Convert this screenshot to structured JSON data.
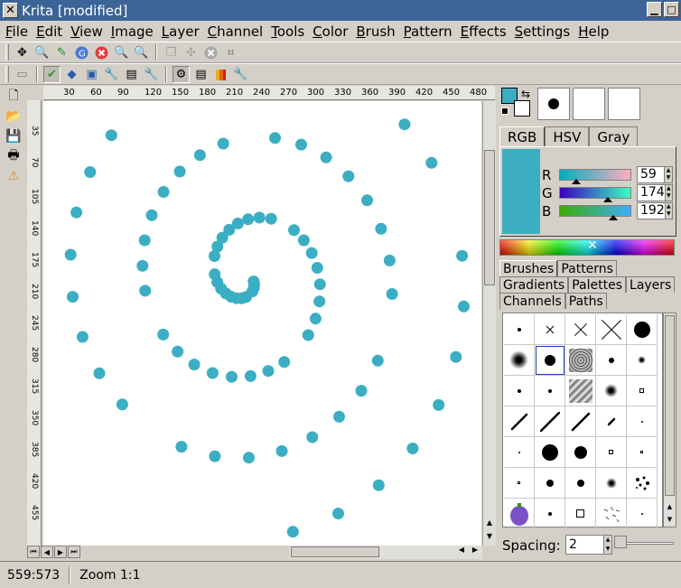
{
  "window": {
    "title": "Krita [modified]"
  },
  "menu": [
    "File",
    "Edit",
    "View",
    "Image",
    "Layer",
    "Channel",
    "Tools",
    "Color",
    "Brush",
    "Pattern",
    "Effects",
    "Settings",
    "Help"
  ],
  "ruler": {
    "h_ticks": [
      "30",
      "60",
      "90",
      "120",
      "150",
      "180",
      "210",
      "240",
      "270",
      "300",
      "330",
      "360",
      "390",
      "420",
      "450",
      "480"
    ],
    "v_ticks": [
      "35",
      "70",
      "105",
      "140",
      "175",
      "210",
      "245",
      "280",
      "315",
      "350",
      "385",
      "420",
      "455"
    ]
  },
  "colors": {
    "accent": "#3baec3",
    "fg": "#3baec3",
    "bg": "#ffffff"
  },
  "color_panel": {
    "tabs": [
      "RGB",
      "HSV",
      "Gray"
    ],
    "active_tab": "RGB",
    "channels": [
      {
        "label": "R",
        "value": "59",
        "fraction": 0.23
      },
      {
        "label": "G",
        "value": "174",
        "fraction": 0.68
      },
      {
        "label": "B",
        "value": "192",
        "fraction": 0.75
      }
    ]
  },
  "docker_tabs": {
    "row1": [
      "Brushes",
      "Patterns"
    ],
    "row2": [
      "Gradients",
      "Palettes",
      "Layers"
    ],
    "row3": [
      "Channels",
      "Paths"
    ],
    "active": "Brushes"
  },
  "brush_options": {
    "spacing_label": "Spacing:",
    "spacing_value": "2"
  },
  "status": {
    "coords": "559:573",
    "zoom": "Zoom 1:1"
  }
}
